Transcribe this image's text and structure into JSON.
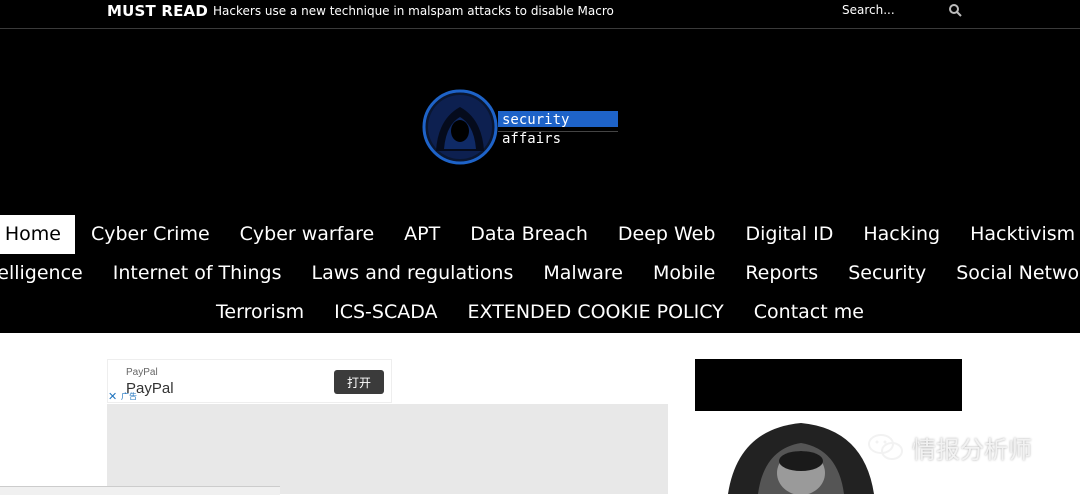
{
  "topbar": {
    "must_read": "MUST READ",
    "ticker": "Hackers use a new technique in malspam attacks to disable Macro",
    "search_placeholder": "Search..."
  },
  "logo": {
    "line1": "security",
    "line2": "affairs"
  },
  "nav": {
    "row1": [
      "Home",
      "Cyber Crime",
      "Cyber warfare",
      "APT",
      "Data Breach",
      "Deep Web",
      "Digital ID",
      "Hacking",
      "Hacktivism"
    ],
    "row2": [
      "Intelligence",
      "Internet of Things",
      "Laws and regulations",
      "Malware",
      "Mobile",
      "Reports",
      "Security",
      "Social Networks"
    ],
    "row3": [
      "Terrorism",
      "ICS-SCADA",
      "EXTENDED COOKIE POLICY",
      "Contact me"
    ],
    "active": "Home"
  },
  "ad": {
    "small_label": "PayPal",
    "name": "PayPal",
    "open_button": "打开",
    "close_symbol": "✕",
    "ad_tag": "广告"
  },
  "watermark": {
    "text": "情报分析师"
  },
  "colors": {
    "header_bg": "#000000",
    "logo_blue": "#1e63c8",
    "nav_text": "#ffffff"
  }
}
